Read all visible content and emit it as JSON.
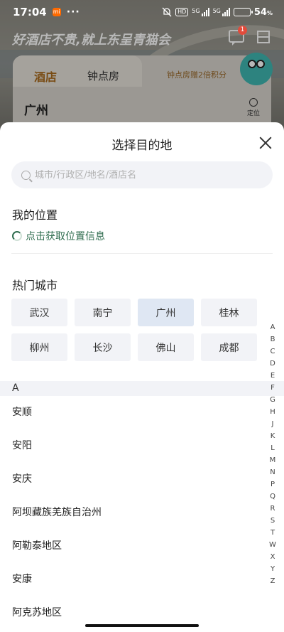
{
  "status_bar": {
    "time": "17:04",
    "mi_badge": "mi",
    "more": "···",
    "hd": "HD",
    "sig1_label": "5G",
    "sig2_label": "5G",
    "battery_percent": "54",
    "battery_suffix": "%",
    "battery_level": 0.54,
    "battery_color": "#f5c518"
  },
  "background_app": {
    "slogan": "好酒店不贵,就上东呈青猫会",
    "message_badge": "1",
    "tab_hotel": "酒店",
    "tab_hourly": "钟点房",
    "promo": "钟点房赠2倍积分",
    "city": "广州",
    "locate_label": "定位"
  },
  "sheet": {
    "title": "选择目的地",
    "search_placeholder": "城市/行政区/地名/酒店名",
    "my_location_title": "我的位置",
    "get_location": "点击获取位置信息",
    "hot_cities_title": "热门城市",
    "hot_cities": [
      {
        "name": "武汉"
      },
      {
        "name": "南宁"
      },
      {
        "name": "广州",
        "selected": true
      },
      {
        "name": "桂林"
      },
      {
        "name": "柳州"
      },
      {
        "name": "长沙"
      },
      {
        "name": "佛山"
      },
      {
        "name": "成都"
      }
    ],
    "current_letter": "A",
    "cities_a": [
      "安顺",
      "安阳",
      "安庆",
      "阿坝藏族羌族自治州",
      "阿勒泰地区",
      "安康",
      "阿克苏地区"
    ],
    "index_letters": [
      "A",
      "B",
      "C",
      "D",
      "E",
      "F",
      "G",
      "H",
      "J",
      "K",
      "L",
      "M",
      "N",
      "P",
      "Q",
      "R",
      "S",
      "T",
      "W",
      "X",
      "Y",
      "Z"
    ]
  },
  "colors": {
    "accent_green": "#2f6d4f",
    "selected_city_bg": "#dfe7f3",
    "chip_bg": "#f2f3f7",
    "badge_red": "#e24b3b"
  }
}
